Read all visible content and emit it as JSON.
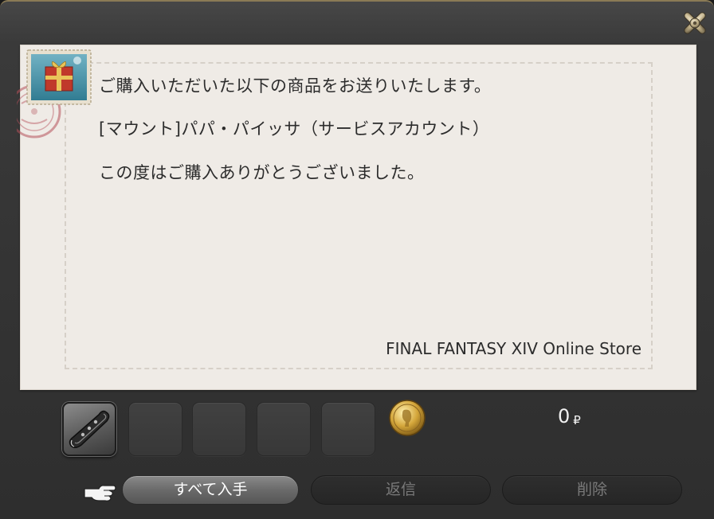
{
  "letter": {
    "lines": [
      "ご購入いただいた以下の商品をお送りいたします。",
      "[マウント]パパ・パイッサ（サービスアカウント）",
      "この度はご購入ありがとうございました。"
    ],
    "signature": "FINAL FANTASY XIV Online Store"
  },
  "attachments": {
    "slots": [
      {
        "filled": true,
        "icon": "ocarina-icon"
      },
      {
        "filled": false
      },
      {
        "filled": false
      },
      {
        "filled": false
      },
      {
        "filled": false
      }
    ],
    "gil_amount": "0",
    "gil_unit": "₽"
  },
  "buttons": {
    "take_all": "すべて入手",
    "reply": "返信",
    "delete": "削除"
  },
  "colors": {
    "panel_bg": "#333333",
    "letter_bg": "#efebe6",
    "button_active": "#6a6a6a",
    "button_disabled_text": "#7a7a7a"
  }
}
